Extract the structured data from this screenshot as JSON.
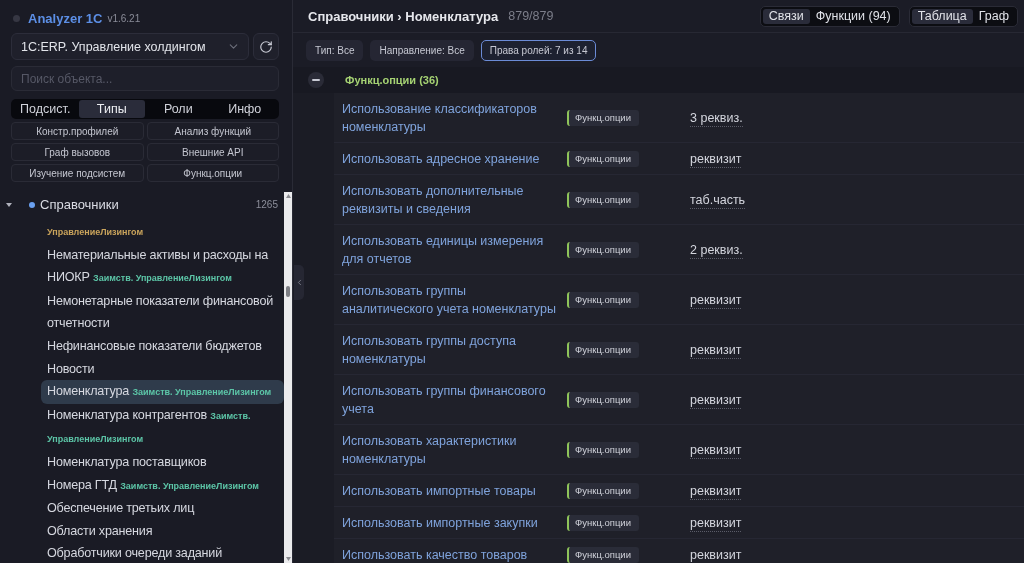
{
  "app": {
    "title": "Analyzer 1C",
    "version": "v1.6.21"
  },
  "sidebar": {
    "config_select": {
      "value": "1C:ERP. Управление холдингом"
    },
    "search": {
      "placeholder": "Поиск объекта..."
    },
    "tabs": [
      {
        "label": "Подсист.",
        "selected": false
      },
      {
        "label": "Типы",
        "selected": true
      },
      {
        "label": "Роли",
        "selected": false
      },
      {
        "label": "Инфо",
        "selected": false
      }
    ],
    "tools": [
      "Констр.профилей",
      "Анализ функций",
      "Граф вызовов",
      "Внешние API",
      "Изучение подсистем",
      "Функц.опции"
    ],
    "tree": [
      {
        "label": "Справочники",
        "count": "1265",
        "expanded": true,
        "children": [
          {
            "tag": "УправлениеЛизингом",
            "color": "#c9a35b",
            "selected": false
          },
          {
            "name": "Нематериальные активы и расходы на НИОКР",
            "tag": "Заимств. УправлениеЛизингом",
            "color": "#5cc5a7",
            "selected": false
          },
          {
            "name": "Немонетарные показатели финансовой отчетности",
            "selected": false
          },
          {
            "name": "Нефинансовые показатели бюджетов",
            "selected": false
          },
          {
            "name": "Новости",
            "selected": false
          },
          {
            "name": "Номенклатура",
            "tag": "Заимств. УправлениеЛизингом",
            "color": "#5cc5a7",
            "selected": true
          },
          {
            "name": "Номенклатура контрагентов",
            "tag": "Заимств. УправлениеЛизингом",
            "color": "#5cc5a7",
            "selected": false
          },
          {
            "name": "Номенклатура поставщиков",
            "selected": false
          },
          {
            "name": "Номера ГТД",
            "tag": "Заимств. УправлениеЛизингом",
            "color": "#5cc5a7",
            "selected": false
          },
          {
            "name": "Обеспечение третьих лиц",
            "selected": false
          },
          {
            "name": "Области хранения",
            "selected": false
          },
          {
            "name": "Обработчики очереди заданий",
            "selected": false
          }
        ]
      }
    ]
  },
  "main": {
    "breadcrumb": "Справочники › Номенклатура",
    "count": "879/879",
    "mode_switch": [
      {
        "label": "Связи",
        "selected": true
      },
      {
        "label": "Функции (94)",
        "selected": false
      }
    ],
    "view_switch": [
      {
        "label": "Таблица",
        "selected": true
      },
      {
        "label": "Граф",
        "selected": false
      }
    ],
    "filters": [
      {
        "label": "Тип: Все",
        "active": false
      },
      {
        "label": "Направление: Все",
        "active": false
      },
      {
        "label": "Права ролей: 7 из 14",
        "active": true
      }
    ],
    "groups": [
      {
        "label": "Функц.опции (36)",
        "expanded": true,
        "rows": [
          {
            "name": "Использование классификаторов номенклатуры",
            "tag": "Функц.опции",
            "kind": "3 реквиз."
          },
          {
            "name": "Использовать адресное хранение",
            "tag": "Функц.опции",
            "kind": "реквизит"
          },
          {
            "name": "Использовать дополнительные реквизиты и сведения",
            "tag": "Функц.опции",
            "kind": "таб.часть"
          },
          {
            "name": "Использовать единицы измерения для отчетов",
            "tag": "Функц.опции",
            "kind": "2 реквиз."
          },
          {
            "name": "Использовать группы аналитического учета номенклатуры",
            "tag": "Функц.опции",
            "kind": "реквизит"
          },
          {
            "name": "Использовать группы доступа номенклатуры",
            "tag": "Функц.опции",
            "kind": "реквизит"
          },
          {
            "name": "Использовать группы финансового учета",
            "tag": "Функц.опции",
            "kind": "реквизит"
          },
          {
            "name": "Использовать характеристики номенклатуры",
            "tag": "Функц.опции",
            "kind": "реквизит"
          },
          {
            "name": "Использовать импортные товары",
            "tag": "Функц.опции",
            "kind": "реквизит"
          },
          {
            "name": "Использовать импортные закупки",
            "tag": "Функц.опции",
            "kind": "реквизит"
          },
          {
            "name": "Использовать качество товаров",
            "tag": "Функц.опции",
            "kind": "реквизит"
          }
        ]
      }
    ]
  }
}
